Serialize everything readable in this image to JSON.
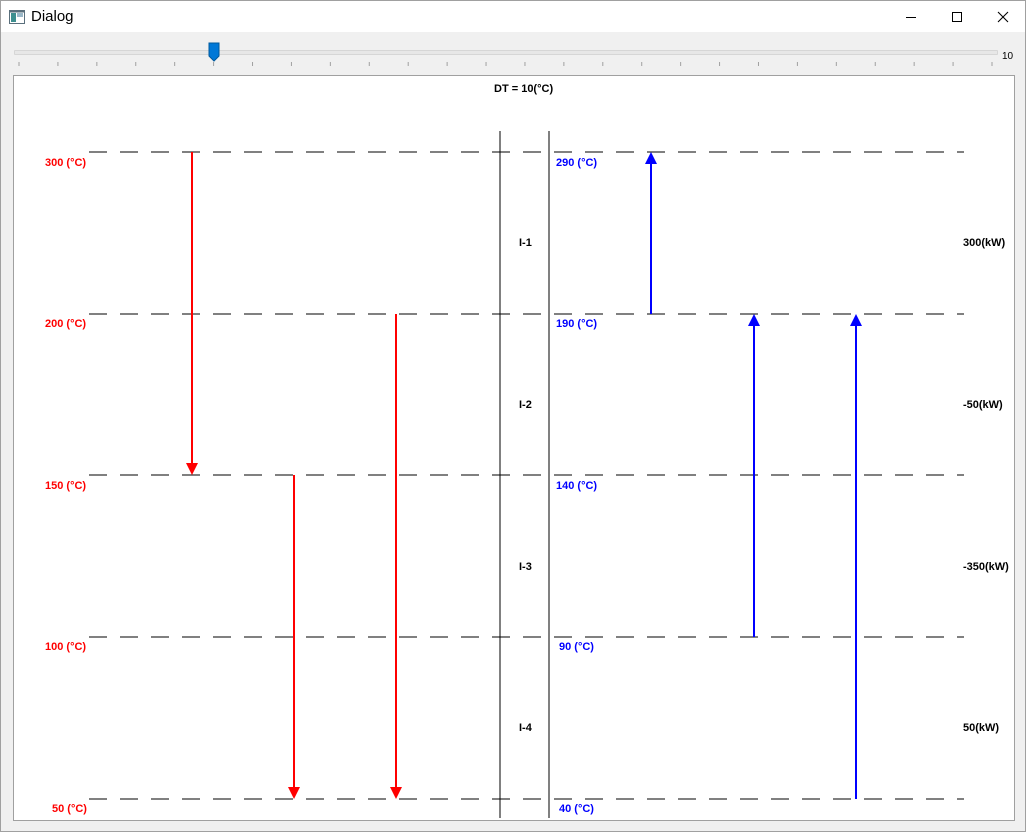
{
  "window": {
    "title": "Dialog",
    "minimize_icon": "minimize-icon",
    "maximize_icon": "maximize-icon",
    "close_icon": "close-icon"
  },
  "slider": {
    "max_label": "10",
    "value_fraction": 0.2
  },
  "diagram": {
    "dt_label": "DT = 10(°C)",
    "hot_temps": [
      "300 (°C)",
      "200 (°C)",
      "150 (°C)",
      "100 (°C)",
      "50 (°C)"
    ],
    "cold_temps": [
      "290 (°C)",
      "190 (°C)",
      "140 (°C)",
      "90 (°C)",
      "40 (°C)"
    ],
    "intervals": [
      "I-1",
      "I-2",
      "I-3",
      "I-4"
    ],
    "heat_balances": [
      "300(kW)",
      "-50(kW)",
      "-350(kW)",
      "50(kW)"
    ],
    "colors": {
      "hot": "#ff0000",
      "cold": "#0000ff",
      "line": "#000000"
    },
    "hot_streams": [
      {
        "from": "300 (°C)",
        "to": "150 (°C)"
      },
      {
        "from": "150 (°C)",
        "to": "50 (°C)"
      },
      {
        "from": "200 (°C)",
        "to": "50 (°C)"
      }
    ],
    "cold_streams": [
      {
        "from": "190 (°C)",
        "to": "290 (°C)"
      },
      {
        "from": "90 (°C)",
        "to": "190 (°C)"
      },
      {
        "from": "40 (°C)",
        "to": "190 (°C)"
      }
    ]
  }
}
